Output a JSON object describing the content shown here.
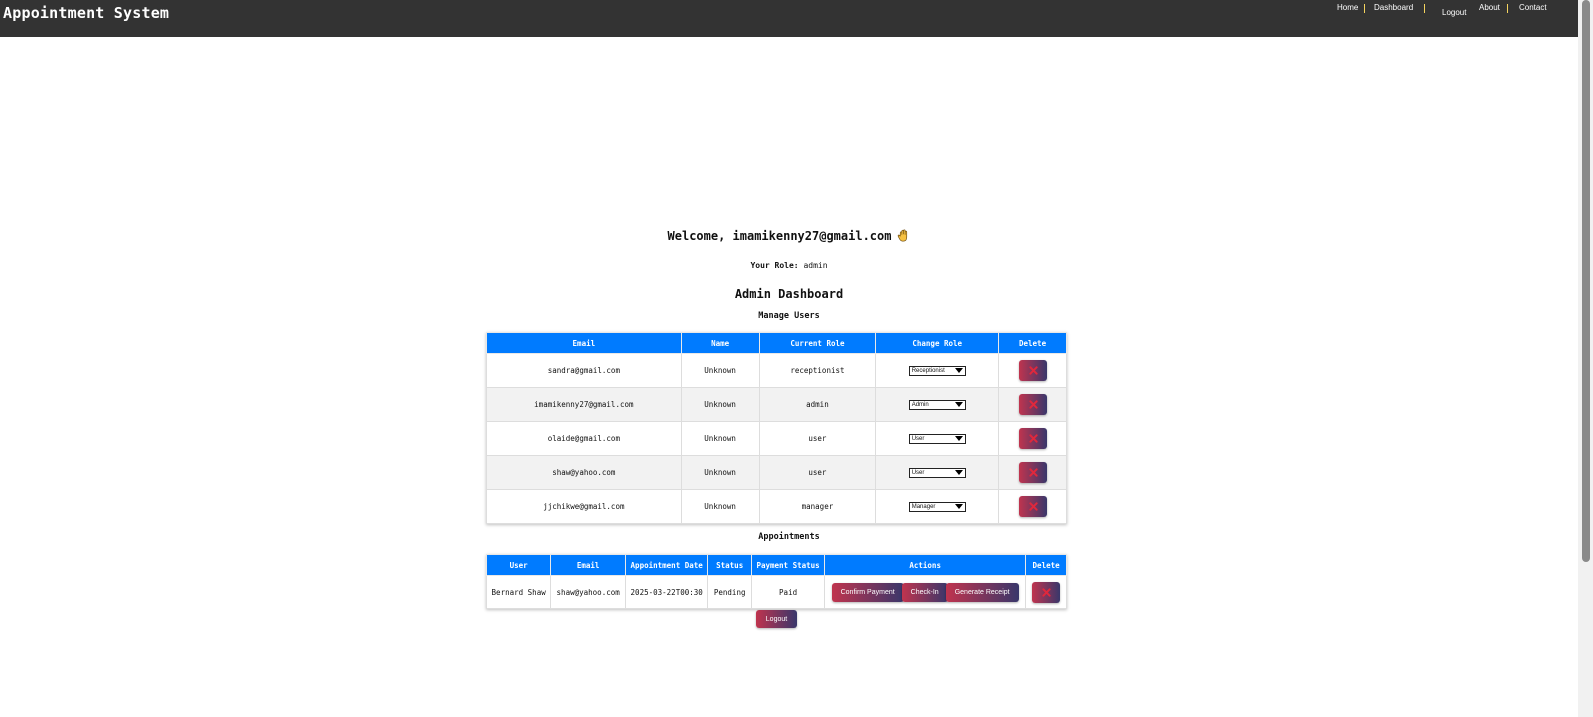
{
  "app": {
    "title": "Appointment System"
  },
  "nav": {
    "items": [
      {
        "label": "Home"
      },
      {
        "label": "Dashboard"
      },
      {
        "label": "Logout"
      },
      {
        "label": "About"
      },
      {
        "label": "Contact"
      }
    ]
  },
  "welcome": {
    "text": "Welcome, imamikenny27@gmail.com",
    "emoji_icon": "waving-hand-icon",
    "role_label": "Your Role:",
    "role_value": "admin"
  },
  "dashboard": {
    "title": "Admin Dashboard"
  },
  "users_section": {
    "heading": "Manage Users",
    "columns": [
      "Email",
      "Name",
      "Current Role",
      "Change Role",
      "Delete"
    ],
    "rows": [
      {
        "email": "sandra@gmail.com",
        "name": "Unknown",
        "role": "receptionist",
        "select": "Receptionist"
      },
      {
        "email": "imamikenny27@gmail.com",
        "name": "Unknown",
        "role": "admin",
        "select": "Admin"
      },
      {
        "email": "olaide@gmail.com",
        "name": "Unknown",
        "role": "user",
        "select": "User"
      },
      {
        "email": "shaw@yahoo.com",
        "name": "Unknown",
        "role": "user",
        "select": "User"
      },
      {
        "email": "jjchikwe@gmail.com",
        "name": "Unknown",
        "role": "manager",
        "select": "Manager"
      }
    ],
    "delete_icon": "close-x-icon"
  },
  "appointments_section": {
    "heading": "Appointments",
    "columns": [
      "User",
      "Email",
      "Appointment Date",
      "Status",
      "Payment Status",
      "Actions",
      "Delete"
    ],
    "rows": [
      {
        "user": "Bernard Shaw",
        "email": "shaw@yahoo.com",
        "date": "2025-03-22T00:30",
        "status": "Pending",
        "payment_status": "Paid",
        "actions": [
          "Confirm Payment",
          "Check-In",
          "Generate Receipt"
        ]
      }
    ]
  },
  "footer": {
    "logout_label": "Logout"
  },
  "colors": {
    "topbar": "#333333",
    "table_header": "#007bff",
    "nav_separator": "#f4d35e",
    "button_gradient_start": "#c0344e",
    "button_gradient_end": "#39376b"
  }
}
